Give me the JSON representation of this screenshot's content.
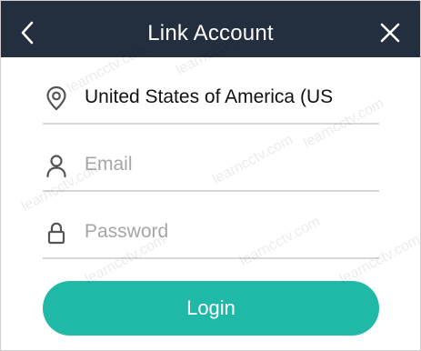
{
  "header": {
    "title": "Link Account",
    "back_icon": "chevron-left-icon",
    "close_icon": "close-icon"
  },
  "form": {
    "country": {
      "icon": "location-pin-icon",
      "value": "United States of America (US"
    },
    "email": {
      "icon": "user-icon",
      "placeholder": "Email",
      "value": ""
    },
    "password": {
      "icon": "lock-icon",
      "placeholder": "Password",
      "value": ""
    },
    "login_label": "Login"
  },
  "watermark_text": "learncctv.com",
  "colors": {
    "header_bg": "#232f3e",
    "accent": "#20b8a7",
    "divider": "#d8d8d8",
    "placeholder": "#a6a6a6"
  }
}
